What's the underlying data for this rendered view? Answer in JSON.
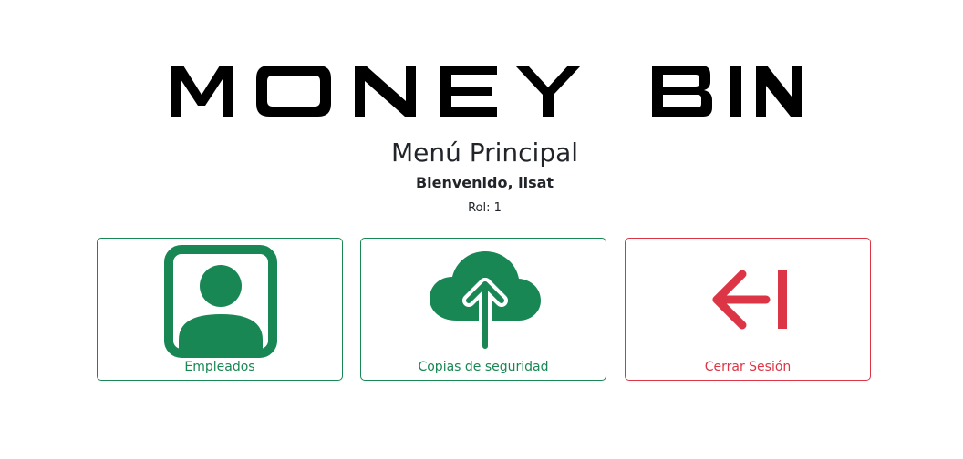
{
  "brand": {
    "logo_text": "MONEY BIN"
  },
  "header": {
    "title": "Menú Principal",
    "welcome": "Bienvenido, lisat",
    "role": "Rol: 1"
  },
  "menu": {
    "items": [
      {
        "label": "Empleados",
        "icon": "person-badge-icon",
        "color": "#198754"
      },
      {
        "label": "Copias de seguridad",
        "icon": "cloud-upload-icon",
        "color": "#198754"
      },
      {
        "label": "Cerrar Sesión",
        "icon": "logout-arrow-icon",
        "color": "#dc3545"
      }
    ]
  },
  "colors": {
    "primary_green": "#198754",
    "danger_red": "#dc3545",
    "text": "#212529"
  }
}
